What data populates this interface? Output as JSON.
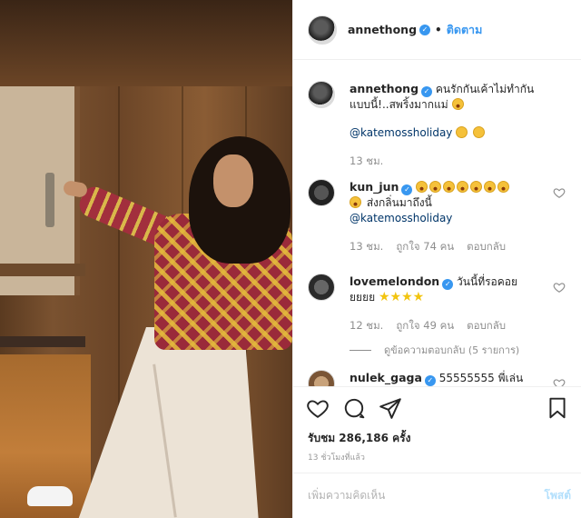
{
  "post": {
    "username": "annethong",
    "follow_label": "ติดตาม",
    "verified_mark": "✓",
    "separator": "•"
  },
  "comments": [
    {
      "username": "annethong",
      "text": "คนรักกันเค้าไม่ทำกันแบบนี้!..สพริ้งมากแม่",
      "mention": "@katemossholiday",
      "time": "13 ชม."
    },
    {
      "username": "kun_jun",
      "text": "ส่งกลิ่นมาถึงนี้",
      "mention": "@katemossholiday",
      "time": "13 ชม.",
      "likes": "ถูกใจ 74 คน",
      "reply": "ตอบกลับ"
    },
    {
      "username": "lovemelondon",
      "text": "วันนี้ที่รอคอย ยยยย",
      "time": "12 ชม.",
      "likes": "ถูกใจ 49 คน",
      "reply": "ตอบกลับ",
      "view_replies": "ดูข้อความตอบกลับ (5 รายการ)"
    },
    {
      "username": "nulek_gaga",
      "text": "55555555 พี่เล่น"
    }
  ],
  "actions": {
    "views": "รับชม 286,186 ครั้ง",
    "time_ago": "13 ชั่วโมงที่แล้ว"
  },
  "add_comment": {
    "placeholder": "เพิ่มความคิดเห็น",
    "post_label": "โพสต์"
  },
  "icons": {
    "like": "heart-icon",
    "comment": "comment-icon",
    "share": "share-icon",
    "save": "bookmark-icon"
  },
  "colors": {
    "link_blue": "#3897f0",
    "mention": "#003569",
    "muted": "#8e8e8e"
  }
}
